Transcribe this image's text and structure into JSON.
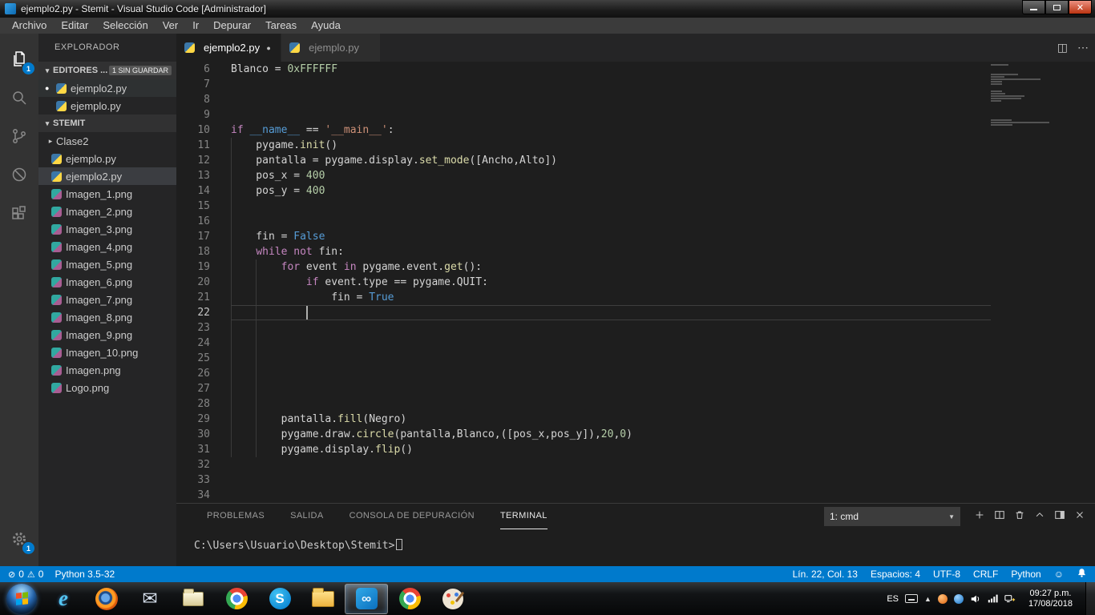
{
  "titlebar": {
    "title": "ejemplo2.py - Stemit - Visual Studio Code [Administrador]"
  },
  "menubar": {
    "items": [
      "Archivo",
      "Editar",
      "Selección",
      "Ver",
      "Ir",
      "Depurar",
      "Tareas",
      "Ayuda"
    ]
  },
  "activitybar": {
    "items": [
      {
        "icon": "explorer-icon",
        "badge": "1",
        "active": true
      },
      {
        "icon": "search-icon"
      },
      {
        "icon": "source-control-icon"
      },
      {
        "icon": "debug-icon"
      },
      {
        "icon": "extensions-icon"
      }
    ],
    "settings_badge": "1"
  },
  "sidebar": {
    "title": "EXPLORADOR",
    "sections": [
      {
        "label": "EDITORES ...",
        "badge": "1 SIN GUARDAR"
      },
      {
        "label": "STEMIT"
      }
    ],
    "open_editors": [
      {
        "name": "ejemplo2.py",
        "modified": true,
        "active": true
      },
      {
        "name": "ejemplo.py",
        "modified": false,
        "active": false
      }
    ],
    "files": [
      {
        "name": "Clase2",
        "type": "folder"
      },
      {
        "name": "ejemplo.py",
        "type": "python"
      },
      {
        "name": "ejemplo2.py",
        "type": "python",
        "selected": true
      },
      {
        "name": "Imagen_1.png",
        "type": "image"
      },
      {
        "name": "Imagen_2.png",
        "type": "image"
      },
      {
        "name": "Imagen_3.png",
        "type": "image"
      },
      {
        "name": "Imagen_4.png",
        "type": "image"
      },
      {
        "name": "Imagen_5.png",
        "type": "image"
      },
      {
        "name": "Imagen_6.png",
        "type": "image"
      },
      {
        "name": "Imagen_7.png",
        "type": "image"
      },
      {
        "name": "Imagen_8.png",
        "type": "image"
      },
      {
        "name": "Imagen_9.png",
        "type": "image"
      },
      {
        "name": "Imagen_10.png",
        "type": "image"
      },
      {
        "name": "Imagen.png",
        "type": "image"
      },
      {
        "name": "Logo.png",
        "type": "image"
      }
    ]
  },
  "editor": {
    "tabs": [
      {
        "label": "ejemplo2.py",
        "modified": true,
        "active": true
      },
      {
        "label": "ejemplo.py",
        "modified": false,
        "active": false
      }
    ],
    "cursor": {
      "line": 22,
      "col": 13
    },
    "code": [
      {
        "n": 6,
        "t": [
          [
            "d",
            "Blanco = "
          ],
          [
            "num",
            "0xFFFFFF"
          ]
        ]
      },
      {
        "n": 7,
        "t": []
      },
      {
        "n": 8,
        "t": []
      },
      {
        "n": 9,
        "t": []
      },
      {
        "n": 10,
        "t": [
          [
            "kw",
            "if"
          ],
          [
            "d",
            " "
          ],
          [
            "bc",
            "__name__"
          ],
          [
            "d",
            " == "
          ],
          [
            "str",
            "'__main__'"
          ],
          [
            "d",
            ":"
          ]
        ]
      },
      {
        "n": 11,
        "t": [
          [
            "d",
            "    pygame."
          ],
          [
            "fn",
            "init"
          ],
          [
            "d",
            "()"
          ]
        ]
      },
      {
        "n": 12,
        "t": [
          [
            "d",
            "    pantalla = pygame.display."
          ],
          [
            "fn",
            "set_mode"
          ],
          [
            "d",
            "([Ancho,Alto])"
          ]
        ]
      },
      {
        "n": 13,
        "t": [
          [
            "d",
            "    pos_x = "
          ],
          [
            "num",
            "400"
          ]
        ]
      },
      {
        "n": 14,
        "t": [
          [
            "d",
            "    pos_y = "
          ],
          [
            "num",
            "400"
          ]
        ]
      },
      {
        "n": 15,
        "t": []
      },
      {
        "n": 16,
        "t": []
      },
      {
        "n": 17,
        "t": [
          [
            "d",
            "    fin = "
          ],
          [
            "bc",
            "False"
          ]
        ]
      },
      {
        "n": 18,
        "t": [
          [
            "d",
            "    "
          ],
          [
            "kw",
            "while"
          ],
          [
            "d",
            " "
          ],
          [
            "kw",
            "not"
          ],
          [
            "d",
            " fin:"
          ]
        ]
      },
      {
        "n": 19,
        "t": [
          [
            "d",
            "        "
          ],
          [
            "kw",
            "for"
          ],
          [
            "d",
            " event "
          ],
          [
            "kw",
            "in"
          ],
          [
            "d",
            " pygame.event."
          ],
          [
            "fn",
            "get"
          ],
          [
            "d",
            "():"
          ]
        ]
      },
      {
        "n": 20,
        "t": [
          [
            "d",
            "            "
          ],
          [
            "kw",
            "if"
          ],
          [
            "d",
            " event.type == pygame.QUIT:"
          ]
        ]
      },
      {
        "n": 21,
        "t": [
          [
            "d",
            "                fin = "
          ],
          [
            "bc",
            "True"
          ]
        ]
      },
      {
        "n": 22,
        "t": [
          [
            "d",
            "            "
          ]
        ]
      },
      {
        "n": 23,
        "t": []
      },
      {
        "n": 24,
        "t": []
      },
      {
        "n": 25,
        "t": []
      },
      {
        "n": 26,
        "t": []
      },
      {
        "n": 27,
        "t": []
      },
      {
        "n": 28,
        "t": []
      },
      {
        "n": 29,
        "t": [
          [
            "d",
            "        pantalla."
          ],
          [
            "fn",
            "fill"
          ],
          [
            "d",
            "(Negro)"
          ]
        ]
      },
      {
        "n": 30,
        "t": [
          [
            "d",
            "        pygame.draw."
          ],
          [
            "fn",
            "circle"
          ],
          [
            "d",
            "(pantalla,Blanco,([pos_x,pos_y]),"
          ],
          [
            "num",
            "20"
          ],
          [
            "d",
            ","
          ],
          [
            "num",
            "0"
          ],
          [
            "d",
            ")"
          ]
        ]
      },
      {
        "n": 31,
        "t": [
          [
            "d",
            "        pygame.display."
          ],
          [
            "fn",
            "flip"
          ],
          [
            "d",
            "()"
          ]
        ]
      },
      {
        "n": 32,
        "t": []
      },
      {
        "n": 33,
        "t": []
      },
      {
        "n": 34,
        "t": []
      }
    ]
  },
  "panel": {
    "tabs": [
      {
        "label": "PROBLEMAS",
        "active": false
      },
      {
        "label": "SALIDA",
        "active": false
      },
      {
        "label": "CONSOLA DE DEPURACIÓN",
        "active": false
      },
      {
        "label": "TERMINAL",
        "active": true
      }
    ],
    "terminal_picker": "1: cmd",
    "terminal_prompt": "C:\\Users\\Usuario\\Desktop\\Stemit>"
  },
  "statusbar": {
    "errors": "0",
    "warnings": "0",
    "interpreter": "Python 3.5-32",
    "cursor_position": "Lín. 22, Col. 13",
    "indentation": "Espacios: 4",
    "encoding": "UTF-8",
    "eol": "CRLF",
    "language": "Python"
  },
  "taskbar": {
    "apps": [
      {
        "id": "internet-explorer"
      },
      {
        "id": "firefox"
      },
      {
        "id": "mail"
      },
      {
        "id": "libraries"
      },
      {
        "id": "chrome"
      },
      {
        "id": "skype"
      },
      {
        "id": "file-explorer"
      },
      {
        "id": "visual-studio-code",
        "active": true
      },
      {
        "id": "chrome-2"
      },
      {
        "id": "paint"
      }
    ],
    "tray": {
      "language": "ES",
      "time": "09:27 p.m.",
      "date": "17/08/2018"
    }
  }
}
